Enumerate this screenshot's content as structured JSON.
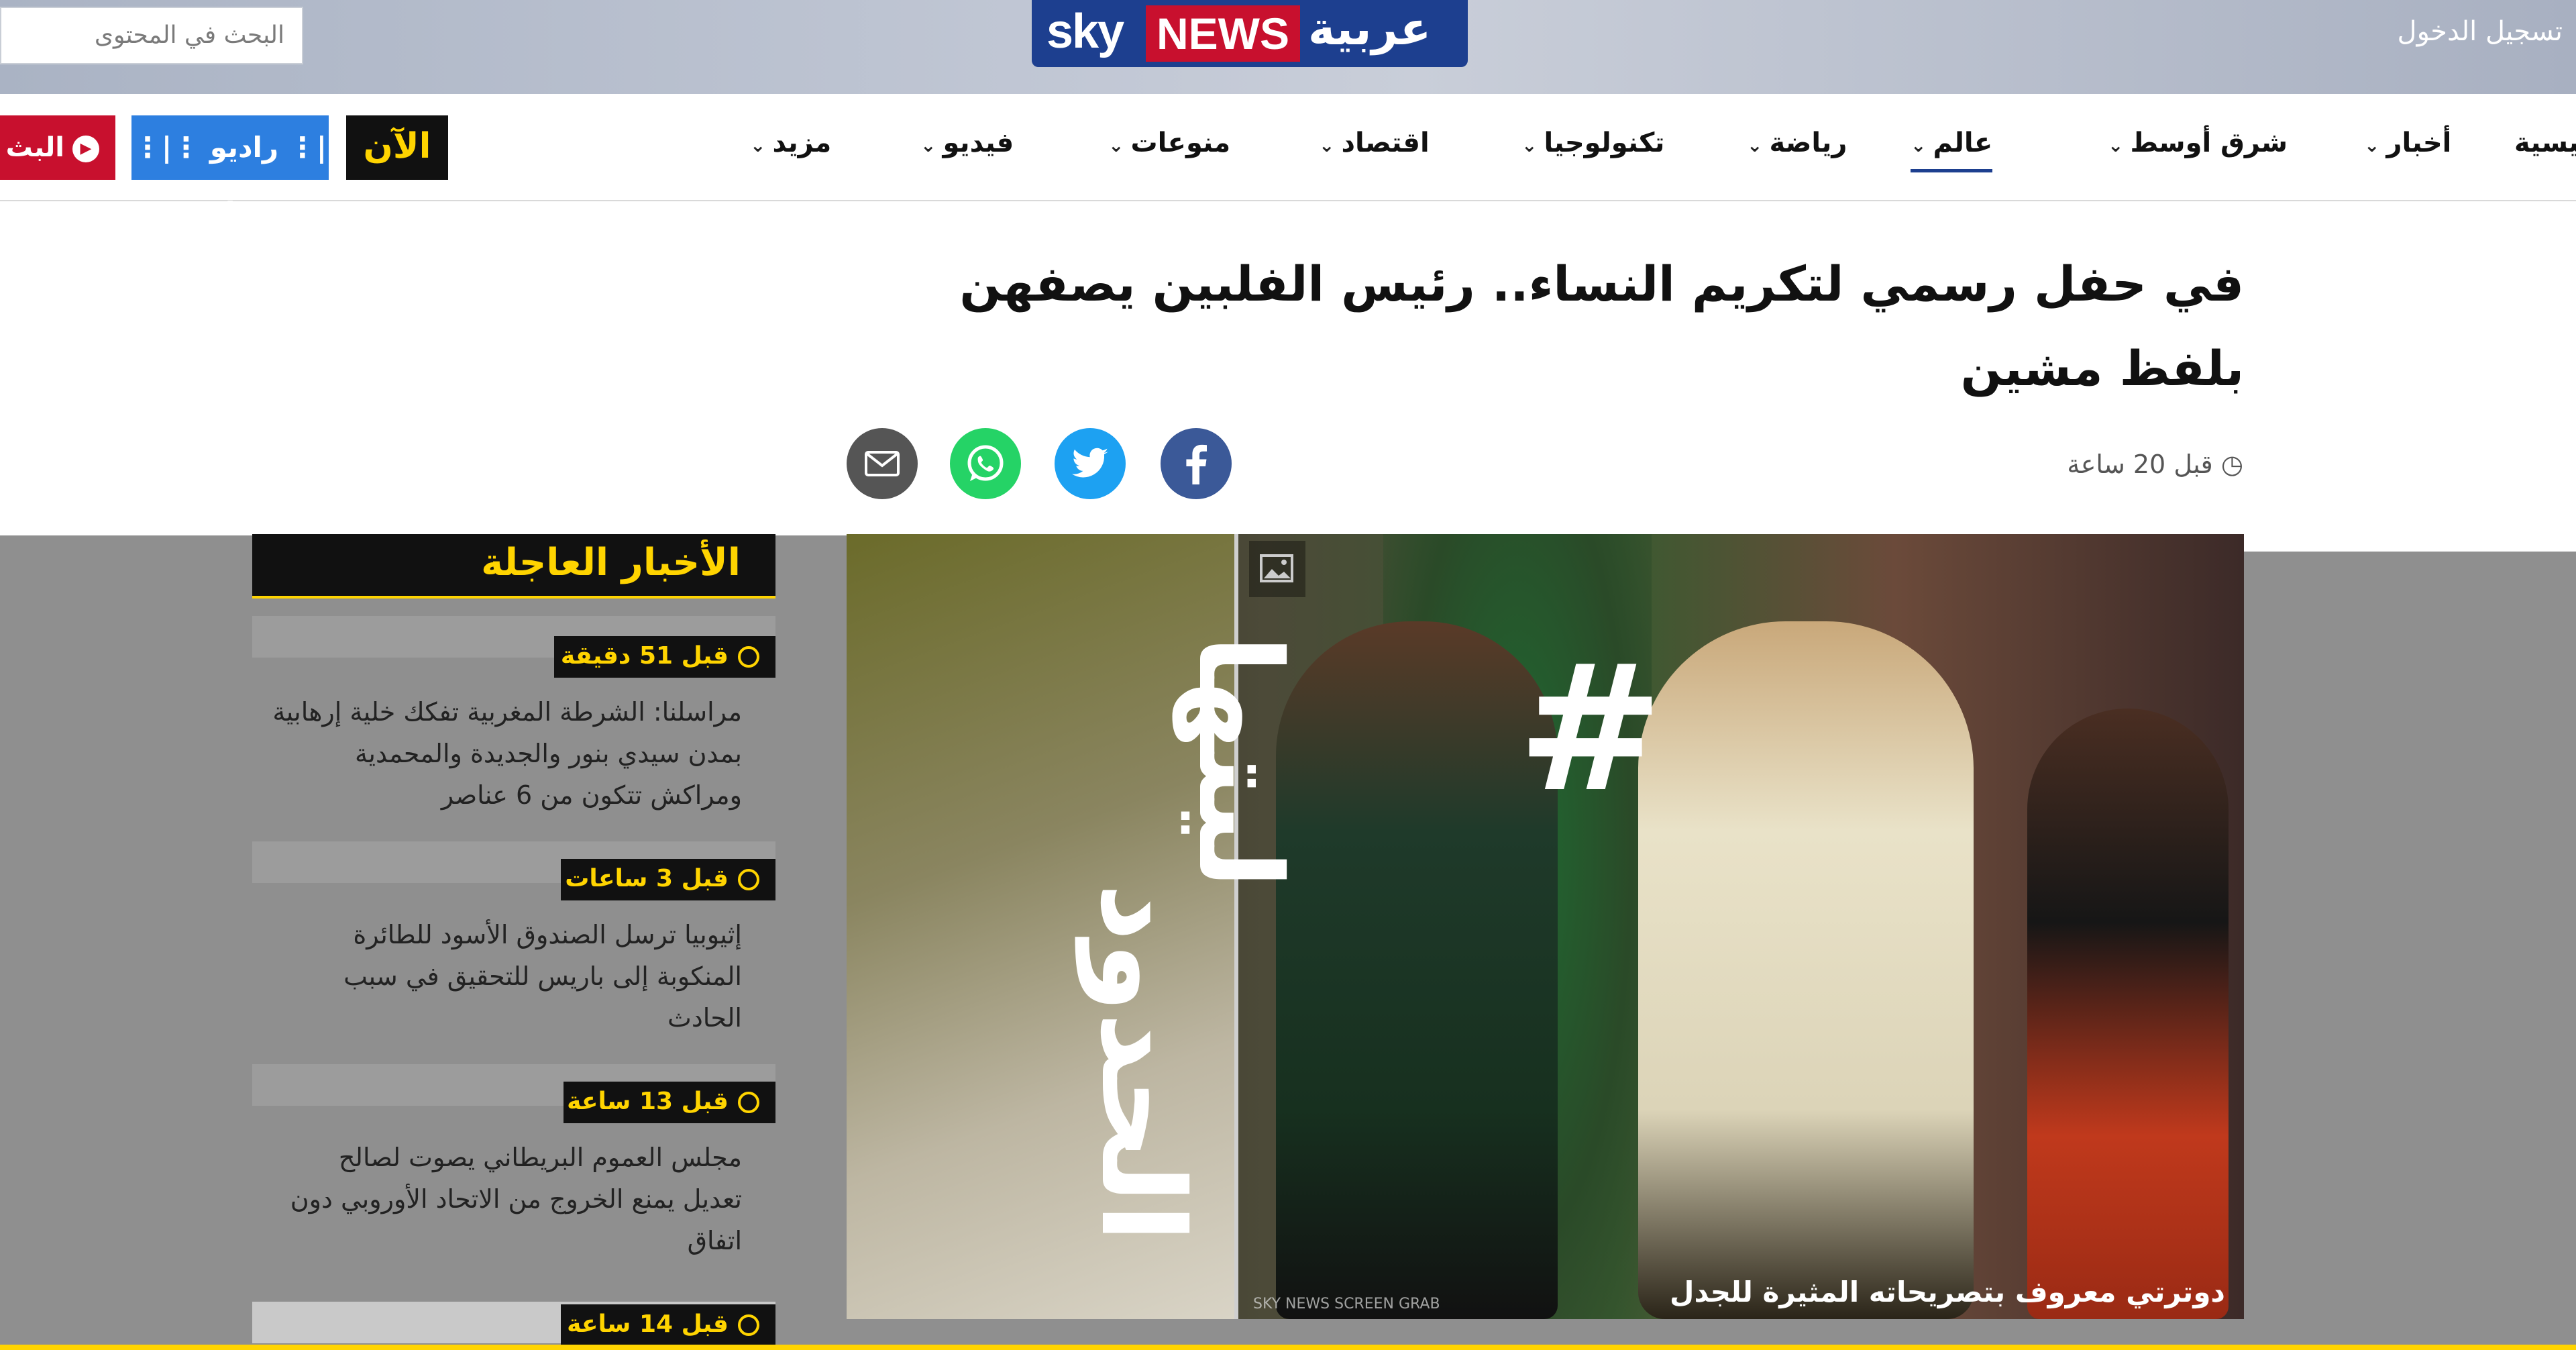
{
  "header": {
    "search_placeholder": "البحث في المحتوى",
    "login_label": "تسجيل الدخول",
    "logo": {
      "sky": "sky",
      "news": "NEWS",
      "arabic": "عربية"
    }
  },
  "nav": {
    "items": [
      {
        "label": "رئيسية"
      },
      {
        "label": "أخبار"
      },
      {
        "label": "شرق أوسط"
      },
      {
        "label": "عالم"
      },
      {
        "label": "رياضة"
      },
      {
        "label": "تكنولوجيا"
      },
      {
        "label": "اقتصاد"
      },
      {
        "label": "منوعات"
      },
      {
        "label": "فيديو"
      },
      {
        "label": "مزيد"
      }
    ],
    "active_index": 3,
    "live_label": "البث",
    "radio_label": "راديو",
    "now_label": "الآن"
  },
  "article": {
    "headline": "في حفل رسمي لتكريم النساء.. رئيس الفلبين يصفهن بلفظ مشين",
    "timestamp": "قبل 20 ساعة",
    "share": [
      "facebook-icon",
      "twitter-icon",
      "whatsapp-icon",
      "email-icon"
    ],
    "colors": {
      "facebook": "#3b5998",
      "twitter": "#1da1f2",
      "whatsapp": "#25d366",
      "email": "#555555"
    }
  },
  "photo": {
    "caption": "دوترتي معروف بتصريحاته المثيرة للجدل",
    "credit": "SKY NEWS SCREEN GRAB",
    "hashtag": {
      "symbol": "#",
      "line1": "ليتها",
      "line2": "الحدود"
    }
  },
  "breaking_news": {
    "title": "الأخبار العاجلة",
    "items": [
      {
        "time": "قبل 51 دقيقة",
        "text": "مراسلنا: الشرطة المغربية تفكك خلية إرهابية بمدن سيدي بنور والجديدة والمحمدية ومراكش تتكون من 6 عناصر"
      },
      {
        "time": "قبل 3 ساعات",
        "text": "إثيوبيا ترسل الصندوق الأسود للطائرة المنكوبة إلى باريس للتحقيق في سبب الحادث"
      },
      {
        "time": "قبل 13 ساعة",
        "text": "مجلس العموم البريطاني يصوت لصالح تعديل يمنع الخروج من الاتحاد الأوروبي دون اتفاق"
      },
      {
        "time": "قبل 14 ساعة",
        "text": ""
      }
    ]
  }
}
